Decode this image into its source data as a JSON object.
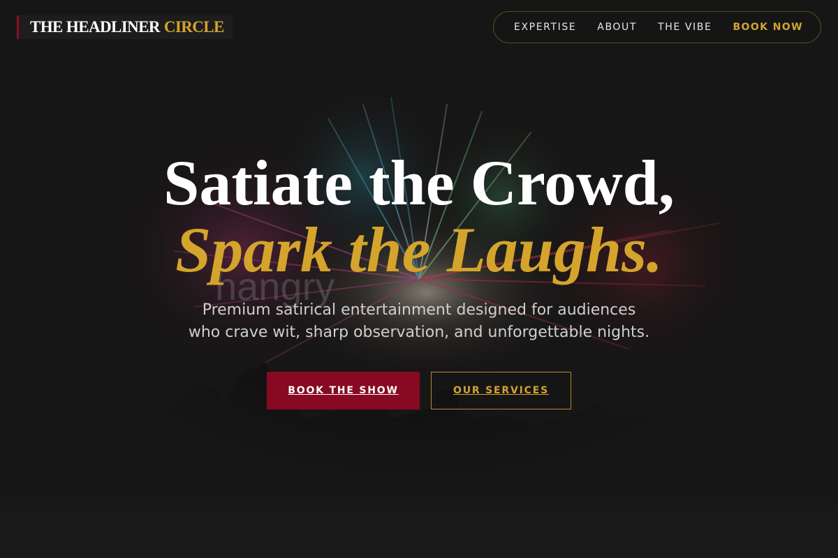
{
  "brand": {
    "name_part1": "THE HEADLINER",
    "name_part2": "CIRCLE"
  },
  "nav": {
    "items": [
      "EXPERTISE",
      "ABOUT",
      "THE VIBE"
    ],
    "cta": "BOOK NOW"
  },
  "hero": {
    "headline_line1": "Satiate the Crowd,",
    "headline_line2": "Spark the Laughs.",
    "background_text": "hangry",
    "subtitle_line1": "Premium satirical entertainment designed for audiences",
    "subtitle_line2": "who crave wit, sharp observation, and unforgettable nights.",
    "primary_button": "BOOK THE SHOW",
    "secondary_button": "OUR SERVICES"
  },
  "colors": {
    "background": "#171616",
    "accent_gold": "#d4a42c",
    "accent_crimson": "#870a22",
    "text_white": "#ffffff"
  },
  "images": {
    "hero_background": "fireworks-over-crowd-silhouette"
  }
}
